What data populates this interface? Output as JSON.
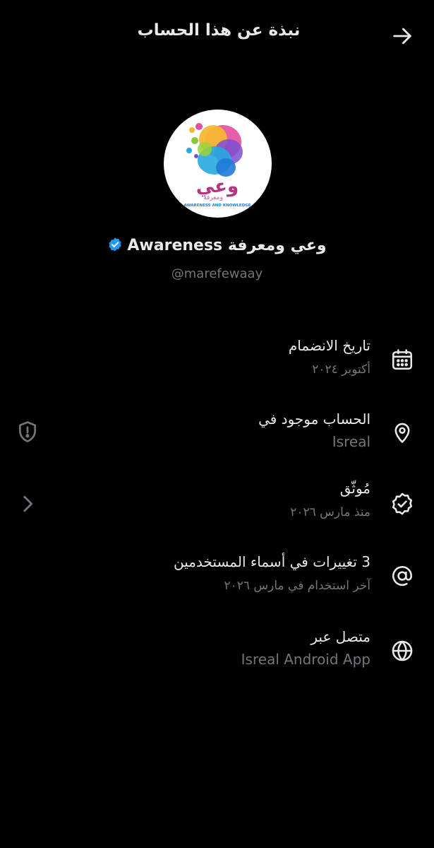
{
  "header": {
    "title": "نبذة عن هذا الحساب",
    "back_icon": "arrow-right-icon"
  },
  "profile": {
    "display_name": "وعي ومعرفة Awareness",
    "handle": "@marefewaay",
    "verified": true,
    "verified_color": "#1d9bf0",
    "avatar": {
      "logo_text": "وعي",
      "logo_subtext": "ومعرفة",
      "logo_caption": "AWARENESS AND KNOWLEDGE"
    }
  },
  "info": [
    {
      "id": "joined",
      "icon": "calendar-icon",
      "label": "تاريخ الانضمام",
      "value": "أكتوبر ٢٠٢٤"
    },
    {
      "id": "location",
      "icon": "location-pin-icon",
      "label": "الحساب موجود في",
      "value": "Isreal",
      "side_icon": "shield-alert-icon"
    },
    {
      "id": "verified",
      "icon": "verified-badge-icon",
      "label": "مُوثّق",
      "value": "منذ مارس ٢٠٢٦",
      "side_icon": "chevron-right-icon"
    },
    {
      "id": "username-changes",
      "icon": "at-sign-icon",
      "label": "3 تغييرات في أسماء المستخدمين",
      "value": "آخر استخدام في مارس ٢٠٢٦"
    },
    {
      "id": "connected-via",
      "icon": "globe-icon",
      "label": "متصل عبر",
      "value": "Isreal Android App"
    }
  ],
  "colors": {
    "background": "#000000",
    "primary_text": "#e7e9ea",
    "secondary_text": "#71767b"
  }
}
